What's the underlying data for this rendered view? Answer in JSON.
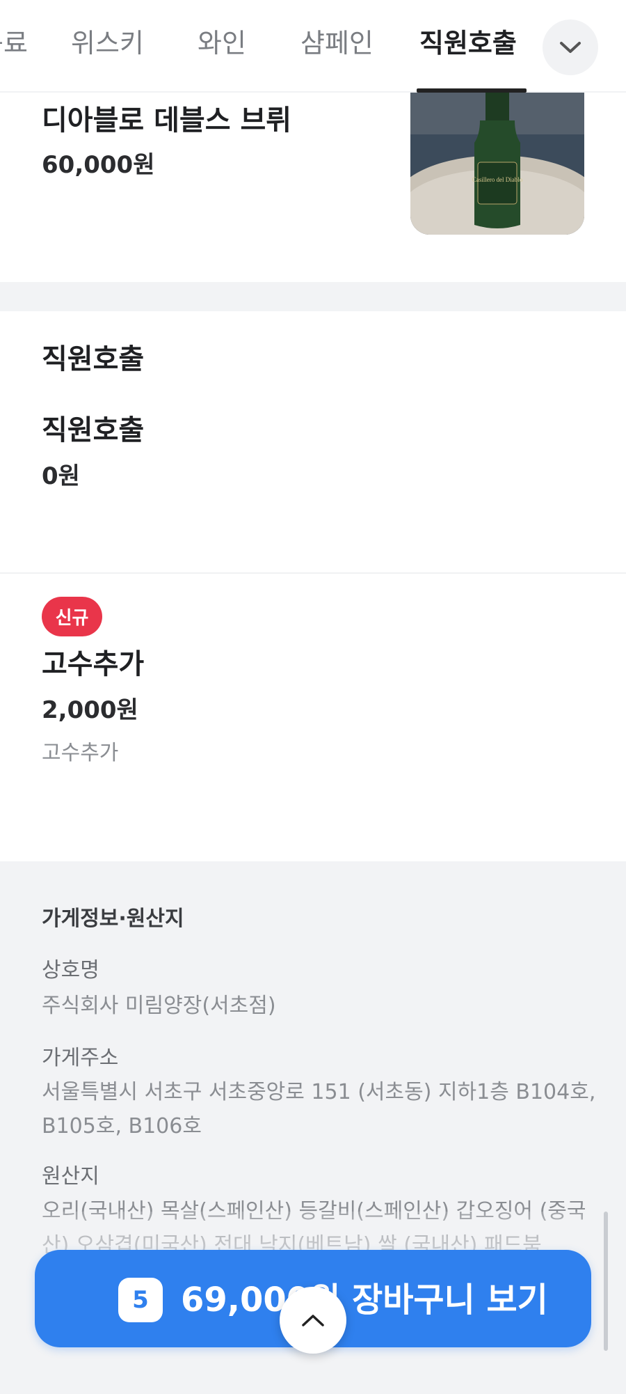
{
  "tabs": [
    {
      "label": "음료",
      "active": false
    },
    {
      "label": "위스키",
      "active": false
    },
    {
      "label": "와인",
      "active": false
    },
    {
      "label": "샴페인",
      "active": false
    },
    {
      "label": "직원호출",
      "active": true
    }
  ],
  "tab_more_icon": "chevron-down-icon",
  "items": {
    "wine": {
      "name": "디아블로 데블스 브뤼",
      "price": "60,000원",
      "image_label": "Casillero del Diablo"
    },
    "staff_call": {
      "name": "직원호출",
      "price": "0원"
    },
    "coriander": {
      "badge": "신규",
      "name": "고수추가",
      "price": "2,000원",
      "desc": "고수추가"
    }
  },
  "section": {
    "title": "직원호출"
  },
  "store_info": {
    "heading": "가게정보·원산지",
    "name_label": "상호명",
    "name_value": "주식회사 미림양장(서초점)",
    "address_label": "가게주소",
    "address_value": "서울특별시 서초구 서초중앙로 151 (서초동) 지하1층 B104호, B105호, B106호",
    "origin_label": "원산지",
    "origin_value": "오리(국내산) 목살(스페인산) 등갈비(스페인산) 갑오징어 (중국산) 오삼겹(미국산) 전대 낙지(베트남) 쌀 (국내산) 패드붐"
  },
  "cart": {
    "count": "5",
    "text": "69,000원 장바구니 보기"
  },
  "scroll_top_icon": "chevron-up-icon",
  "colors": {
    "accent": "#2f80ee",
    "badge": "#e9354a",
    "background": "#f2f3f5"
  }
}
